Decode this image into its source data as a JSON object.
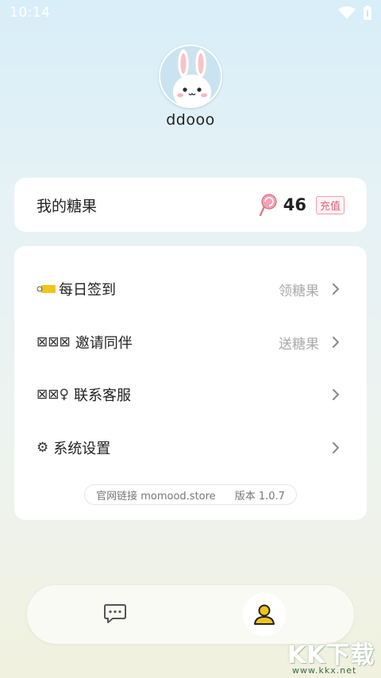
{
  "status_bar": {
    "time": "10:14"
  },
  "profile": {
    "username": "ddooo"
  },
  "candy": {
    "title": "我的糖果",
    "count": "46",
    "recharge_label": "充值"
  },
  "menu": {
    "items": [
      {
        "icon_text": "",
        "label": "每日签到",
        "hint": "领糖果"
      },
      {
        "icon_text": "⊠⊠⊠",
        "label": "邀请同伴",
        "hint": "送糖果"
      },
      {
        "icon_text": "⊠⊠♀",
        "label": "联系客服",
        "hint": ""
      },
      {
        "icon_text": "⚙",
        "label": "系统设置",
        "hint": ""
      }
    ],
    "footer": {
      "site_label": "官网链接 momood.store",
      "version_label": "版本 1.0.7"
    }
  },
  "watermark": {
    "logo_text": "KK下载",
    "url": "www.kkx.net"
  },
  "colors": {
    "accent_pink": "#e2607a",
    "icon_yellow": "#f2c31b",
    "hint_gray": "#aaaaaa"
  },
  "icons": [
    "wifi-icon",
    "battery-icon",
    "rabbit-avatar",
    "lollipop-icon",
    "tag-icon",
    "chevron-right-icon",
    "chat-icon",
    "profile-icon"
  ]
}
